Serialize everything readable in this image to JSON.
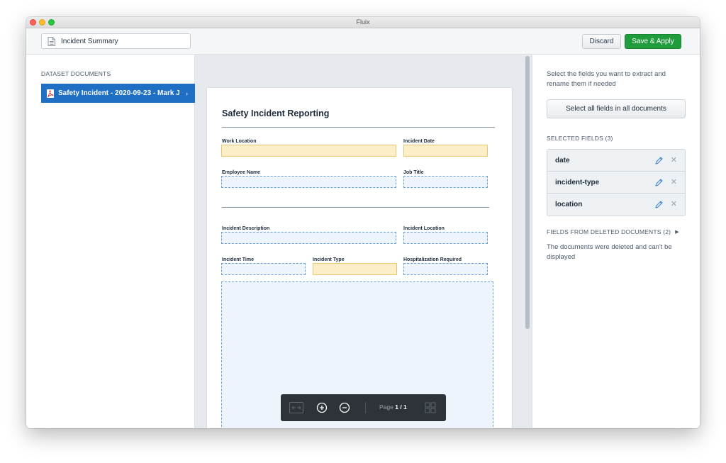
{
  "window": {
    "title": "Fluix"
  },
  "toolbar": {
    "document_title": "Incident Summary",
    "discard_label": "Discard",
    "save_label": "Save & Apply",
    "save_color": "#1f9d3d"
  },
  "left": {
    "heading": "DATASET DOCUMENTS",
    "documents": [
      {
        "label": "Safety Incident - 2020-09-23 - Mark J...",
        "icon": "pdf-icon",
        "selected": true
      }
    ],
    "accent_color": "#1f6fc5"
  },
  "document": {
    "title": "Safety Incident Reporting",
    "fields": {
      "work_location": "Work Location",
      "incident_date": "Incident Date",
      "employee_name": "Employee Name",
      "job_title": "Job Title",
      "incident_description": "Incident Description",
      "incident_location": "Incident Location",
      "incident_time": "Incident Time",
      "incident_type": "Incident Type",
      "hospitalization_required": "Hospitalization Required"
    }
  },
  "pdf_toolbar": {
    "page_prefix": "Page",
    "page_value": "1 / 1",
    "icons": [
      "fit-width-icon",
      "zoom-in-icon",
      "zoom-out-icon",
      "thumbnails-icon"
    ]
  },
  "right": {
    "help_text": "Select the fields you want to extract and rename them if needed",
    "select_all_label": "Select all fields in all documents",
    "selected_heading": "SELECTED FIELDS (3)",
    "selected_fields": [
      {
        "name": "date"
      },
      {
        "name": "incident-type"
      },
      {
        "name": "location"
      }
    ],
    "deleted_heading": "FIELDS FROM DELETED DOCUMENTS (2)",
    "deleted_text": "The documents were deleted and can't be displayed"
  }
}
